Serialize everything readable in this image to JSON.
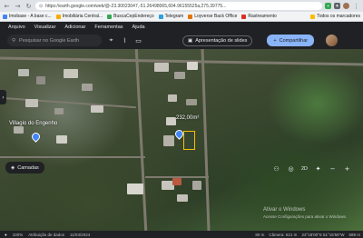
{
  "browser": {
    "url": "https://earth.google.com/web/@-23.30023047,-51.26498065,604.96155525a,275.39775...",
    "nav_back": "←",
    "nav_forward": "→",
    "nav_reload": "↻",
    "bookmarks": [
      {
        "label": "Imobase - A base c...",
        "color": "#4285f4"
      },
      {
        "label": "Imobiliária Central...",
        "color": "#f9ab00"
      },
      {
        "label": "BuscaCepEndereço",
        "color": "#34a853"
      },
      {
        "label": "Telegram",
        "color": "#2aa1da"
      },
      {
        "label": "Loyverse Back Office",
        "color": "#e37400"
      },
      {
        "label": "Rastreamento",
        "color": "#d93025"
      }
    ],
    "all_bookmarks": "Todos os marcadores"
  },
  "menu": [
    "Arquivo",
    "Visualizar",
    "Adicionar",
    "Ferramentas",
    "Ajuda"
  ],
  "toolbar": {
    "search_placeholder": "Pesquisar no Google Earth",
    "present_label": "Apresentação de slides",
    "share_label": "Compartilhar"
  },
  "map": {
    "place_label": "Villagio do Engenho",
    "parcel_label": "232,00m²",
    "layers_label": "Camadas",
    "zoom_level": "2D",
    "watermark_line1": "Ativar o Windows",
    "watermark_line2": "Acesse Configurações para ativar o Windows."
  },
  "status": {
    "left": "100%",
    "data": "Atribuição de dados",
    "date": "11/03/2024",
    "scale": "80 m",
    "camera": "Câmera: 621 m",
    "coords": "23°18'00\"S 51°15'56\"W",
    "alt": "599 m"
  },
  "colors": {
    "accent": "#8ab4f8",
    "toolbar_bg": "#202124",
    "parcel_outline": "#fbbc04",
    "pin": "#4285f4"
  }
}
